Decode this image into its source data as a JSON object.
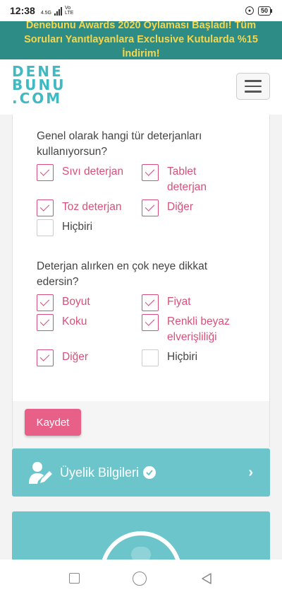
{
  "status_bar": {
    "time": "12:38",
    "network_small": "4.5G",
    "network_type_top": "Vo",
    "network_type_bottom": "LTE",
    "battery": "50"
  },
  "banner": {
    "line1": "Denebunu Awards 2020 Oylaması Başladı! Tüm",
    "line2": "Soruları Yanıtlayanlara Exclusive Kutularda %15",
    "line3": "İndirim!",
    "text_color": "#f6d64a",
    "bg_color": "#2e8c86"
  },
  "header": {
    "logo_line1": "DENE",
    "logo_line2": "BUNU",
    "logo_line3": ".COM",
    "logo_color": "#3fb9c2"
  },
  "survey": {
    "q1": {
      "text": "Genel olarak hangi tür deterjanları kullanıyorsun?",
      "options": [
        {
          "label": "Sıvı deterjan",
          "checked": true
        },
        {
          "label": "Tablet deterjan",
          "checked": true
        },
        {
          "label": "Toz deterjan",
          "checked": true
        },
        {
          "label": "Diğer",
          "checked": true
        },
        {
          "label": "Hiçbiri",
          "checked": false
        }
      ]
    },
    "q2": {
      "text": "Deterjan alırken en çok neye dikkat edersin?",
      "options": [
        {
          "label": "Boyut",
          "checked": true
        },
        {
          "label": "Fiyat",
          "checked": true
        },
        {
          "label": "Koku",
          "checked": true
        },
        {
          "label": "Renkli beyaz elverişliliği",
          "checked": true
        },
        {
          "label": "Diğer",
          "checked": true
        },
        {
          "label": "Hiçbiri",
          "checked": false
        }
      ]
    },
    "save_label": "Kaydet",
    "accent_color": "#d8507a"
  },
  "profile": {
    "label": "Üyelik Bilgileri",
    "icon": "user-edit-icon",
    "bg_color": "#6cc5cb"
  }
}
